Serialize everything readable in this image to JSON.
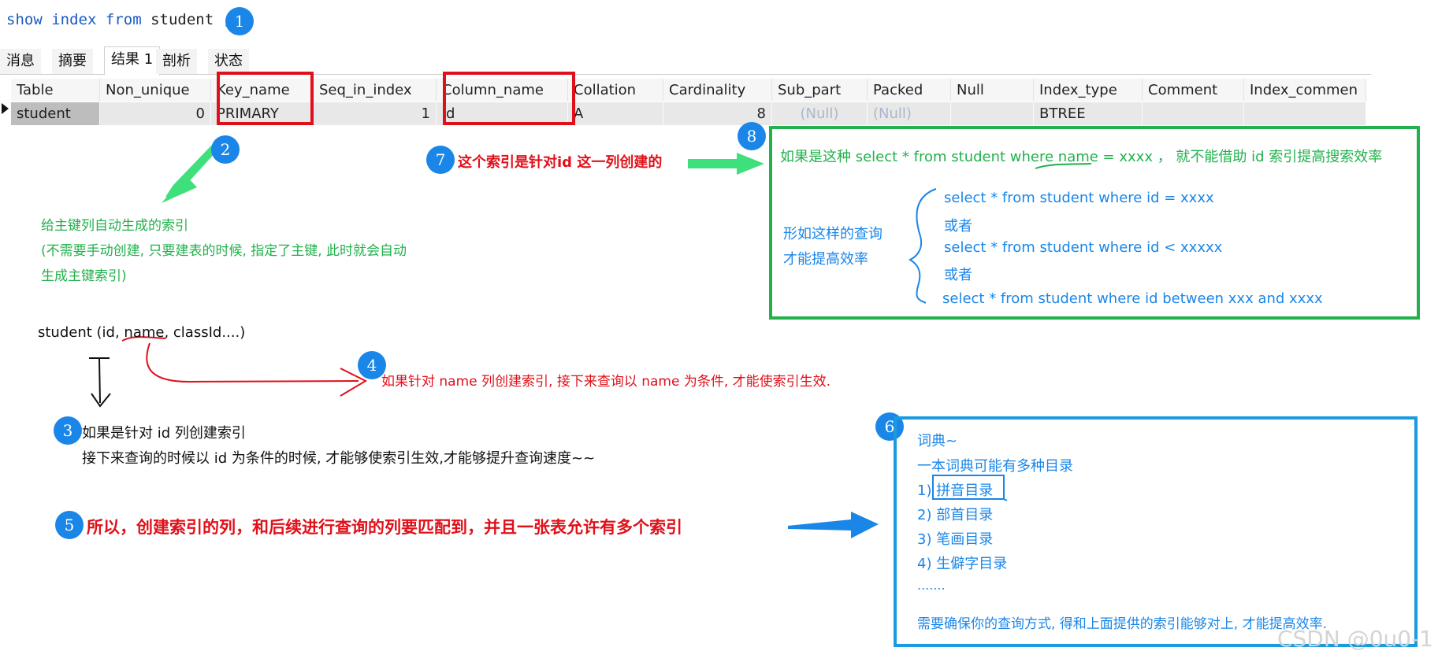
{
  "query": {
    "kw1": "show",
    "kw2": "index",
    "kw3": "from",
    "rest": "student ;"
  },
  "tabs": [
    "消息",
    "摘要",
    "结果 1",
    "剖析",
    "状态"
  ],
  "grid": {
    "headers": [
      "Table",
      "Non_unique",
      "Key_name",
      "Seq_in_index",
      "Column_name",
      "Collation",
      "Cardinality",
      "Sub_part",
      "Packed",
      "Null",
      "Index_type",
      "Comment",
      "Index_commen"
    ],
    "row": [
      "student",
      "0",
      "PRIMARY",
      "1",
      "id",
      "A",
      "8",
      "(Null)",
      "(Null)",
      "",
      "BTREE",
      "",
      ""
    ]
  },
  "badges": [
    "1",
    "2",
    "3",
    "4",
    "5",
    "6",
    "7",
    "8"
  ],
  "note2": {
    "line1": "给主键列自动生成的索引",
    "line2": "(不需要手动创建, 只要建表的时候, 指定了主键, 此时就会自动",
    "line3": "生成主键索引)"
  },
  "schema_text": "student (id, name, classId....)",
  "note3": {
    "line1": "如果是针对 id 列创建索引",
    "line2": "接下来查询的时候以 id 为条件的时候, 才能够使索引生效,才能够提升查询速度~~"
  },
  "note4": "如果针对 name 列创建索引, 接下来查询以 name 为条件, 才能使索引生效.",
  "note5": "所以，创建索引的列，和后续进行查询的列要匹配到，并且一张表允许有多个索引",
  "note7": "这个索引是针对id 这一列创建的",
  "box8": {
    "top": "如果是这种  select * from student where name = xxxx   ，  就不能借助 id 索引提高搜索效率",
    "left1": "形如这样的查询",
    "left2": "才能提高效率",
    "q1": "select * from student where id = xxxx",
    "or1": "或者",
    "q2": "select * from student where id < xxxxx",
    "or2": "或者",
    "q3": "select * from student where id between xxx and xxxx"
  },
  "box6": {
    "l1": "词典~",
    "l2": "一本词典可能有多种目录",
    "l3": "1) 拼音目录",
    "l4": "2) 部首目录",
    "l5": "3) 笔画目录",
    "l6": "4) 生僻字目录",
    "l7": ".......",
    "l8": "需要确保你的查询方式, 得和上面提供的索引能够对上, 才能提高效率."
  },
  "watermark": "CSDN @0u0-1",
  "colors": {
    "red": "#e0101a",
    "green": "#22b14c",
    "blue": "#1a86e8",
    "keyword": "#1a5bc4"
  }
}
